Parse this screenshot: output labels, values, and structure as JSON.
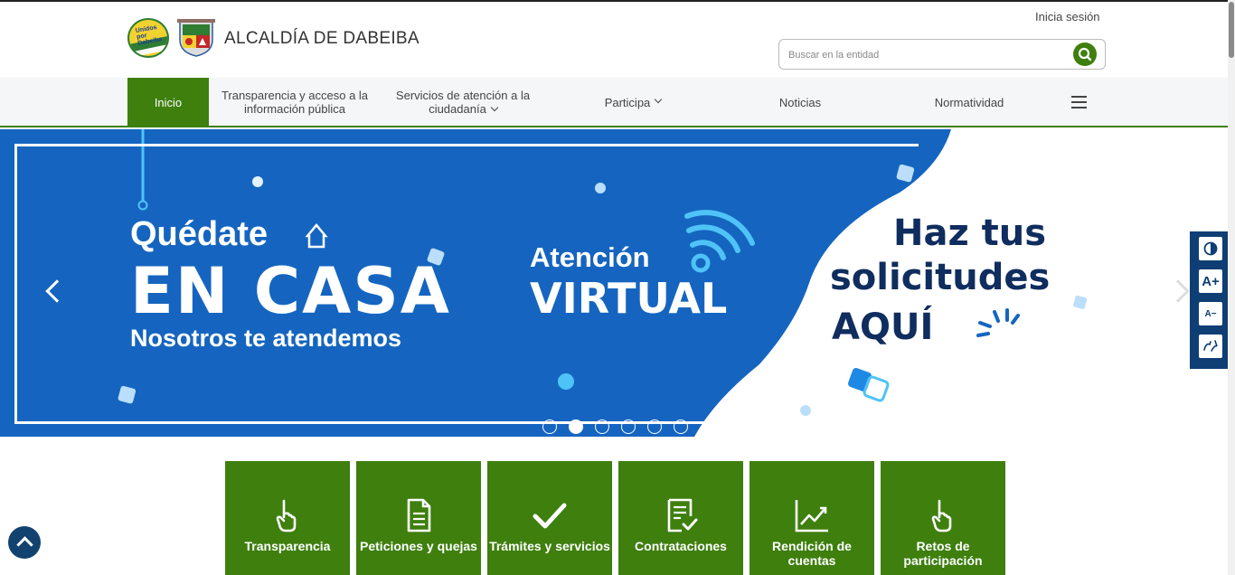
{
  "header": {
    "logo_text": "Unidos por Dabeiba",
    "entity_name": "ALCALDÍA DE DABEIBA",
    "login_label": "Inicia sesión",
    "search_placeholder": "Buscar en la entidad"
  },
  "nav": {
    "items": [
      {
        "label": "Inicio",
        "active": true
      },
      {
        "label": "Transparencia y acceso a la información pública"
      },
      {
        "label": "Servicios de atención a la ciudadanía",
        "has_dropdown": true
      },
      {
        "label": "Participa",
        "has_dropdown": true
      },
      {
        "label": "Noticias"
      },
      {
        "label": "Normatividad"
      }
    ],
    "menu_icon": "hamburger-icon"
  },
  "banner": {
    "kicker": "Quédate",
    "headline": "EN CASA",
    "subline": "Nosotros te atendemos",
    "atencion": "Atención",
    "virtual": "VIRTUAL",
    "haz_line1": "Haz tus",
    "haz_line2": "solicitudes",
    "haz_line3": "AQUÍ",
    "slide_count": 6,
    "active_slide": 2
  },
  "accessibility": {
    "buttons": [
      "contrast-icon",
      "A+",
      "A−",
      "sign-language-icon"
    ]
  },
  "cards": [
    {
      "label": "Transparencia",
      "icon": "pointing-hand-icon"
    },
    {
      "label": "Peticiones y quejas",
      "icon": "document-icon"
    },
    {
      "label": "Trámites y servicios",
      "icon": "check-icon"
    },
    {
      "label": "Contrataciones",
      "icon": "checklist-icon"
    },
    {
      "label": "Rendición de cuentas",
      "icon": "trend-chart-icon"
    },
    {
      "label": "Retos de participación",
      "icon": "pointing-hand-icon"
    }
  ],
  "colors": {
    "primary_green": "#3e7f0e",
    "banner_blue": "#1565c0",
    "navy": "#0f2d5e"
  }
}
